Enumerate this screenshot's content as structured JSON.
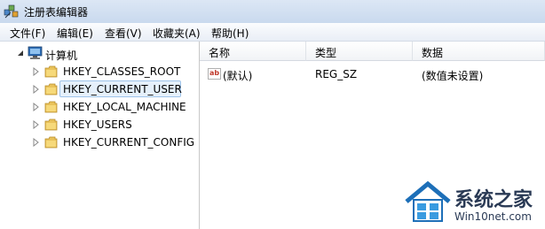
{
  "window": {
    "title": "注册表编辑器"
  },
  "menu": [
    "文件(F)",
    "编辑(E)",
    "查看(V)",
    "收藏夹(A)",
    "帮助(H)"
  ],
  "tree": {
    "root": "计算机",
    "items": [
      {
        "label": "HKEY_CLASSES_ROOT",
        "selected": false
      },
      {
        "label": "HKEY_CURRENT_USER",
        "selected": true
      },
      {
        "label": "HKEY_LOCAL_MACHINE",
        "selected": false
      },
      {
        "label": "HKEY_USERS",
        "selected": false
      },
      {
        "label": "HKEY_CURRENT_CONFIG",
        "selected": false
      }
    ]
  },
  "values": {
    "columns": [
      "名称",
      "类型",
      "数据"
    ],
    "rows": [
      {
        "icon": "string-value-icon",
        "icon_text": "ab",
        "name": "(默认)",
        "type": "REG_SZ",
        "data": "(数值未设置)"
      }
    ]
  },
  "watermark": {
    "main": "系统之家",
    "sub": "Win10net.com"
  },
  "colors": {
    "selection_bg": "#e5f0fb",
    "selection_border": "#9ec3ea",
    "folder": "#e9c25a",
    "titlebar": "#dce7f5"
  }
}
